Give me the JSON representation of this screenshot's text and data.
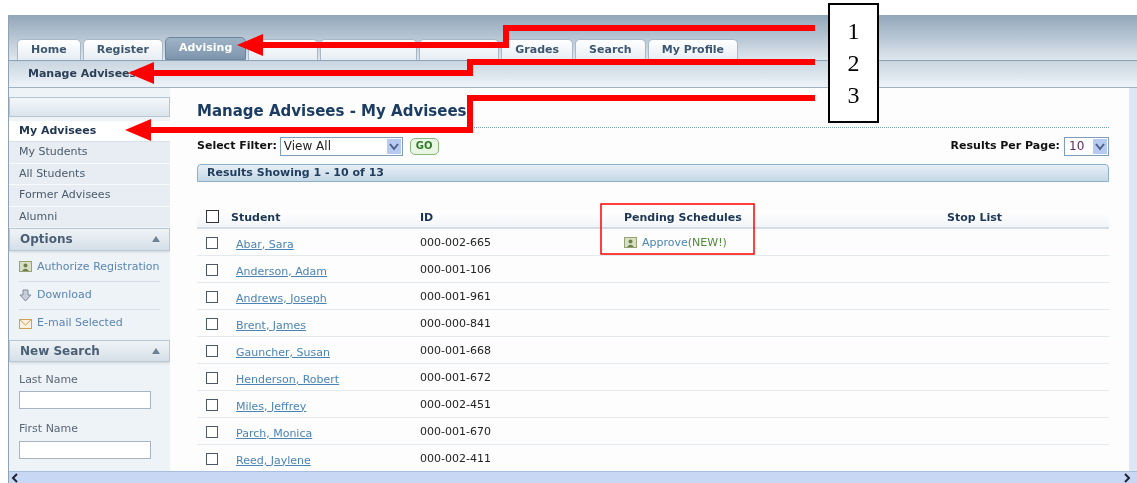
{
  "tabs": [
    {
      "label": "Home",
      "selected": false
    },
    {
      "label": "Register",
      "selected": false
    },
    {
      "label": "Advising",
      "selected": true
    },
    {
      "selected": false
    },
    {
      "selected": false
    },
    {
      "selected": false
    },
    {
      "label": "Grades",
      "selected": false
    },
    {
      "label": "Search",
      "selected": false
    },
    {
      "label": "My Profile",
      "selected": false
    }
  ],
  "subnav": [
    "Manage Advisees"
  ],
  "sidebar": {
    "items": [
      {
        "label": "My Advisees",
        "selected": true
      },
      {
        "label": "My Students",
        "selected": false
      },
      {
        "label": "All Students",
        "selected": false
      },
      {
        "label": "Former Advisees",
        "selected": false
      },
      {
        "label": "Alumni",
        "selected": false
      }
    ],
    "options": {
      "title": "Options",
      "items": [
        {
          "label": "Authorize Registration",
          "kind": "person"
        },
        {
          "label": "Download",
          "kind": "download"
        },
        {
          "label": "E-mail Selected",
          "kind": "mail"
        }
      ]
    },
    "new_search": {
      "title": "New Search",
      "fields": [
        "Last Name",
        "First Name"
      ]
    }
  },
  "page_title": "Manage Advisees - My Advisees",
  "filter": {
    "label": "Select Filter:",
    "value": "View All",
    "button": "GO"
  },
  "per_page": {
    "label": "Results Per Page:",
    "value": "10"
  },
  "results_banner": "Results Showing 1 - 10 of 13",
  "table": {
    "all_checked": false,
    "columns": [
      "Student",
      "ID",
      "Pending Schedules",
      "Stop List"
    ],
    "rows": [
      {
        "student": "Abar, Sara",
        "id": "000-002-665",
        "checked": false,
        "pending": {
          "action": "Approve",
          "note": "(NEW!)"
        }
      },
      {
        "student": "Anderson, Adam",
        "id": "000-001-106",
        "checked": false
      },
      {
        "student": "Andrews, Joseph",
        "id": "000-001-961",
        "checked": false
      },
      {
        "student": "Brent, James",
        "id": "000-000-841",
        "checked": false
      },
      {
        "student": "Gauncher, Susan",
        "id": "000-001-668",
        "checked": false
      },
      {
        "student": "Henderson, Robert",
        "id": "000-001-672",
        "checked": false
      },
      {
        "student": "Miles, Jeffrey",
        "id": "000-002-451",
        "checked": false
      },
      {
        "student": "Parch, Monica",
        "id": "000-001-670",
        "checked": false
      },
      {
        "student": "Reed, Jaylene",
        "id": "000-002-411",
        "checked": false
      }
    ]
  },
  "callouts": [
    "1",
    "2",
    "3"
  ]
}
